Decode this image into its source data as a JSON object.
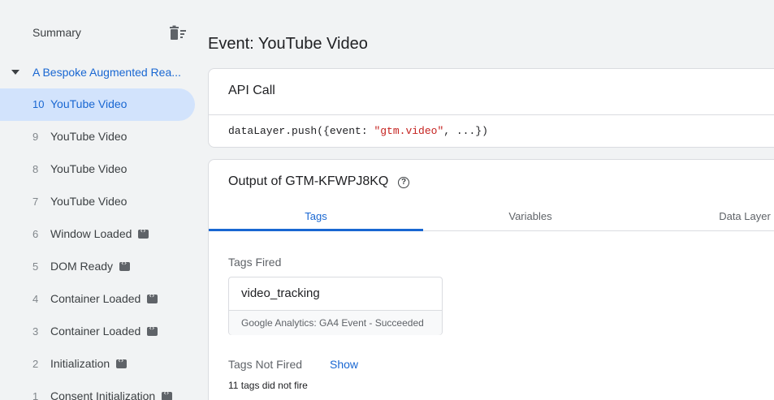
{
  "sidebar": {
    "summary_label": "Summary",
    "container_label": "A Bespoke Augmented Rea...",
    "events": [
      {
        "num": "10",
        "label": "YouTube Video",
        "selected": true,
        "code": false
      },
      {
        "num": "9",
        "label": "YouTube Video",
        "selected": false,
        "code": false
      },
      {
        "num": "8",
        "label": "YouTube Video",
        "selected": false,
        "code": false
      },
      {
        "num": "7",
        "label": "YouTube Video",
        "selected": false,
        "code": false
      },
      {
        "num": "6",
        "label": "Window Loaded",
        "selected": false,
        "code": true
      },
      {
        "num": "5",
        "label": "DOM Ready",
        "selected": false,
        "code": true
      },
      {
        "num": "4",
        "label": "Container Loaded",
        "selected": false,
        "code": true
      },
      {
        "num": "3",
        "label": "Container Loaded",
        "selected": false,
        "code": true
      },
      {
        "num": "2",
        "label": "Initialization",
        "selected": false,
        "code": true
      },
      {
        "num": "1",
        "label": "Consent Initialization",
        "selected": false,
        "code": true
      }
    ]
  },
  "main": {
    "title": "Event: YouTube Video",
    "api_call": {
      "title": "API Call",
      "code_prefix": "dataLayer.push({event: ",
      "code_string": "\"gtm.video\"",
      "code_suffix": ", ...})"
    },
    "output": {
      "title": "Output of GTM-KFWPJ8KQ",
      "tabs": [
        "Tags",
        "Variables",
        "Data Layer"
      ],
      "active_tab": "Tags",
      "tags_fired_heading": "Tags Fired",
      "fired_tag": {
        "name": "video_tracking",
        "status": "Google Analytics: GA4 Event - Succeeded"
      },
      "tags_not_fired_heading": "Tags Not Fired",
      "show_label": "Show",
      "not_fired_text": "11 tags did not fire"
    }
  },
  "colors": {
    "accent": "#1967d2",
    "selected_bg": "#d2e3fc",
    "code_string": "#c5221f",
    "background": "#f1f3f4"
  }
}
